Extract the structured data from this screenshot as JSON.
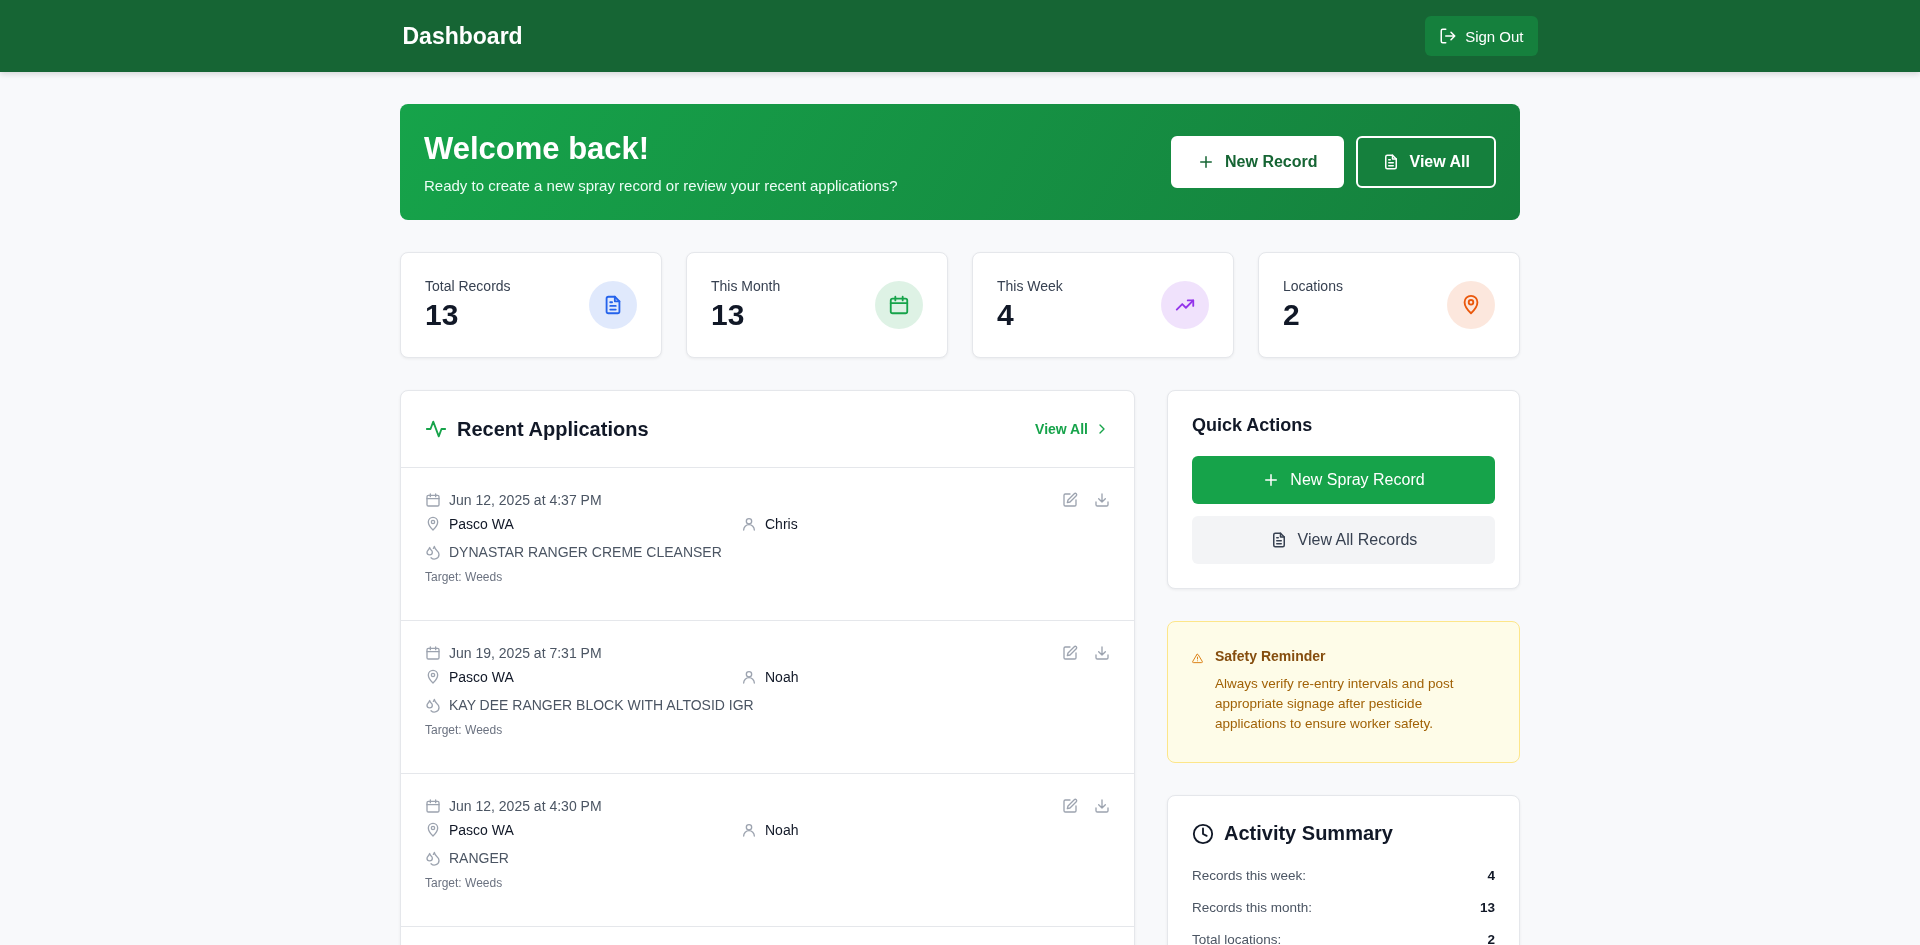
{
  "header": {
    "title": "Dashboard",
    "sign_out": "Sign Out"
  },
  "welcome": {
    "title": "Welcome back!",
    "subtitle": "Ready to create a new spray record or review your recent applications?",
    "buttons": [
      {
        "label": "New Record",
        "kind": "primary"
      },
      {
        "label": "View All",
        "kind": "outline"
      }
    ]
  },
  "stats": [
    {
      "label": "Total Records",
      "value": "13",
      "kind": "document",
      "color": "#2563eb"
    },
    {
      "label": "This Month",
      "value": "13",
      "kind": "calendar",
      "color": "#16a34a"
    },
    {
      "label": "This Week",
      "value": "4",
      "kind": "trend",
      "color": "#9333ea"
    },
    {
      "label": "Locations",
      "value": "2",
      "kind": "pin",
      "color": "#ea580c"
    }
  ],
  "recent": {
    "title": "Recent Applications",
    "view_all": "View All",
    "rows": [
      {
        "date": "Jun 12, 2025 at 4:37 PM",
        "location": "Pasco WA",
        "person": "Chris",
        "product": "DYNASTAR RANGER CREME CLEANSER",
        "target": "Target: Weeds"
      },
      {
        "date": "Jun 19, 2025 at 7:31 PM",
        "location": "Pasco WA",
        "person": "Noah",
        "product": "KAY DEE RANGER BLOCK WITH ALTOSID IGR",
        "target": "Target: Weeds"
      },
      {
        "date": "Jun 12, 2025 at 4:30 PM",
        "location": "Pasco WA",
        "person": "Noah",
        "product": "RANGER",
        "target": "Target: Weeds"
      }
    ]
  },
  "quick_actions": {
    "title": "Quick Actions",
    "buttons": [
      {
        "label": "New Spray Record",
        "kind": "primary"
      },
      {
        "label": "View All Records",
        "kind": "secondary"
      }
    ]
  },
  "safety": {
    "title": "Safety Reminder",
    "text": "Always verify re-entry intervals and post appropriate signage after pesticide applications to ensure worker safety."
  },
  "activity": {
    "title": "Activity Summary",
    "rows": [
      {
        "label": "Records this week:",
        "value": "4"
      },
      {
        "label": "Records this month:",
        "value": "13"
      },
      {
        "label": "Total locations:",
        "value": "2"
      }
    ]
  }
}
